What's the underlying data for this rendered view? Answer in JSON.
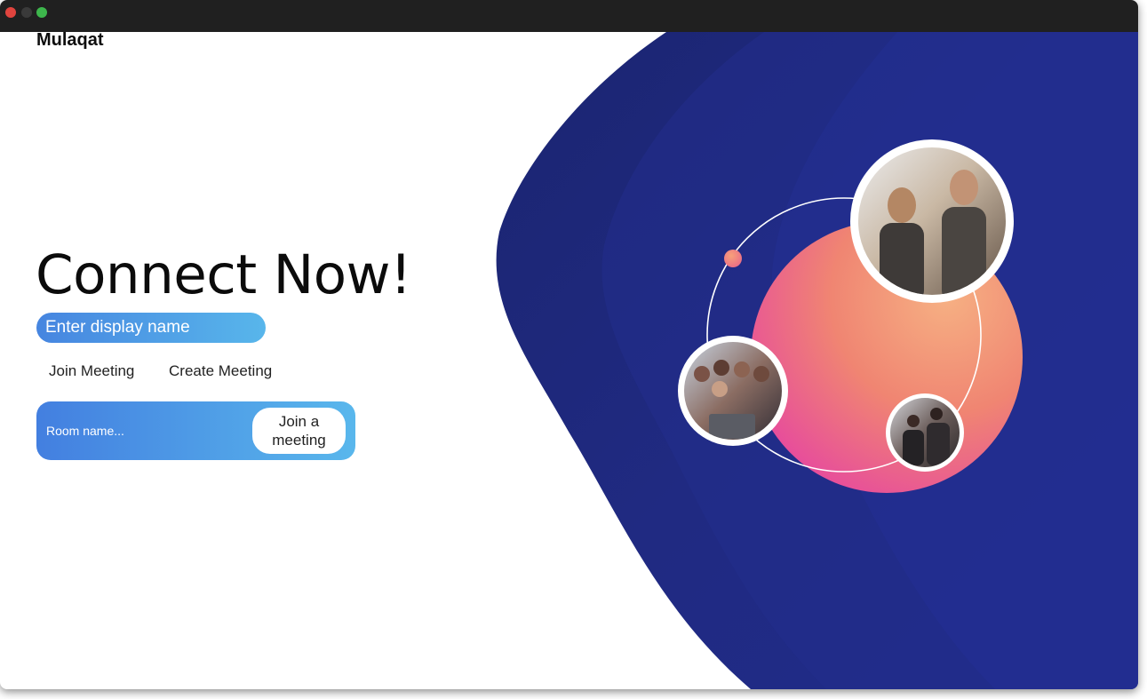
{
  "app": {
    "brand": "Mulaqat"
  },
  "hero": {
    "heading": "Connect Now!"
  },
  "form": {
    "display_name_placeholder": "Enter display name",
    "tabs": [
      {
        "label": "Join Meeting"
      },
      {
        "label": "Create Meeting"
      }
    ],
    "room_placeholder": "Room name...",
    "join_button_label": "Join a meeting"
  },
  "colors": {
    "accent_start": "#4685e0",
    "accent_end": "#58b6eb",
    "panel_navy": "#1f2a80",
    "orb_orange": "#f39a6e",
    "orb_pink": "#e9559b"
  },
  "icons": {
    "window_controls": [
      "close-icon",
      "minimize-icon",
      "maximize-icon"
    ]
  }
}
